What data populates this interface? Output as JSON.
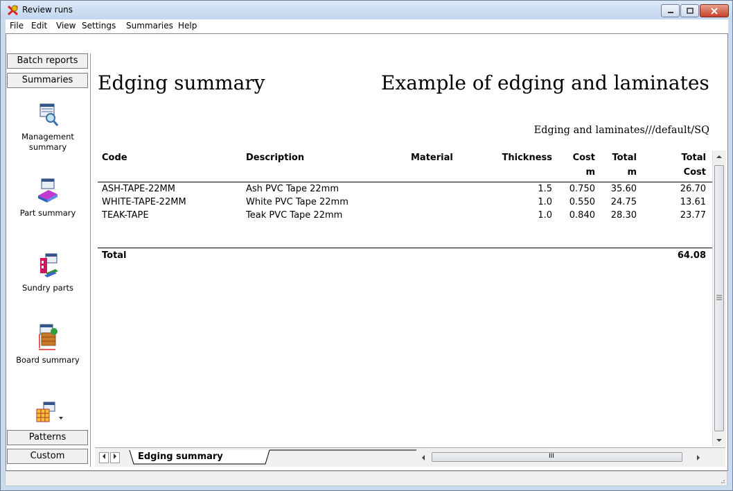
{
  "window": {
    "title": "Review runs"
  },
  "menu": [
    "File",
    "Edit",
    "View",
    "Settings",
    "Summaries",
    "Help"
  ],
  "sidebar": {
    "tabs_top": [
      "Batch reports",
      "Summaries"
    ],
    "items": [
      {
        "label": "Management summary",
        "icon": "management-summary-icon"
      },
      {
        "label": "Part summary",
        "icon": "part-summary-icon"
      },
      {
        "label": "Sundry parts",
        "icon": "sundry-parts-icon"
      },
      {
        "label": "Board summary",
        "icon": "board-summary-icon"
      }
    ],
    "tabs_bottom": [
      "Patterns",
      "Custom"
    ]
  },
  "report": {
    "title": "Edging summary",
    "heading_right": "Example of edging and laminates",
    "subheading": "Edging and laminates///default/SQ",
    "columns": [
      {
        "line1": "Code",
        "line2": ""
      },
      {
        "line1": "Description",
        "line2": ""
      },
      {
        "line1": "Material",
        "line2": ""
      },
      {
        "line1": "Thickness",
        "line2": ""
      },
      {
        "line1": "Cost",
        "line2": "m"
      },
      {
        "line1": "Total",
        "line2": "m"
      },
      {
        "line1": "Total",
        "line2": "Cost"
      }
    ],
    "rows": [
      {
        "code": "ASH-TAPE-22MM",
        "description": "Ash PVC Tape 22mm",
        "material": "",
        "thickness": "1.5",
        "cost_m": "0.750",
        "total_m": "35.60",
        "total_cost": "26.70"
      },
      {
        "code": "WHITE-TAPE-22MM",
        "description": "White PVC Tape 22mm",
        "material": "",
        "thickness": "1.0",
        "cost_m": "0.550",
        "total_m": "24.75",
        "total_cost": "13.61"
      },
      {
        "code": "TEAK-TAPE",
        "description": "Teak PVC Tape 22mm",
        "material": "",
        "thickness": "1.0",
        "cost_m": "0.840",
        "total_m": "28.30",
        "total_cost": "23.77"
      }
    ],
    "total_label": "Total",
    "total_value": "64.08"
  },
  "sheet_tabs": [
    "Edging summary"
  ],
  "hscroll_marker": "III"
}
